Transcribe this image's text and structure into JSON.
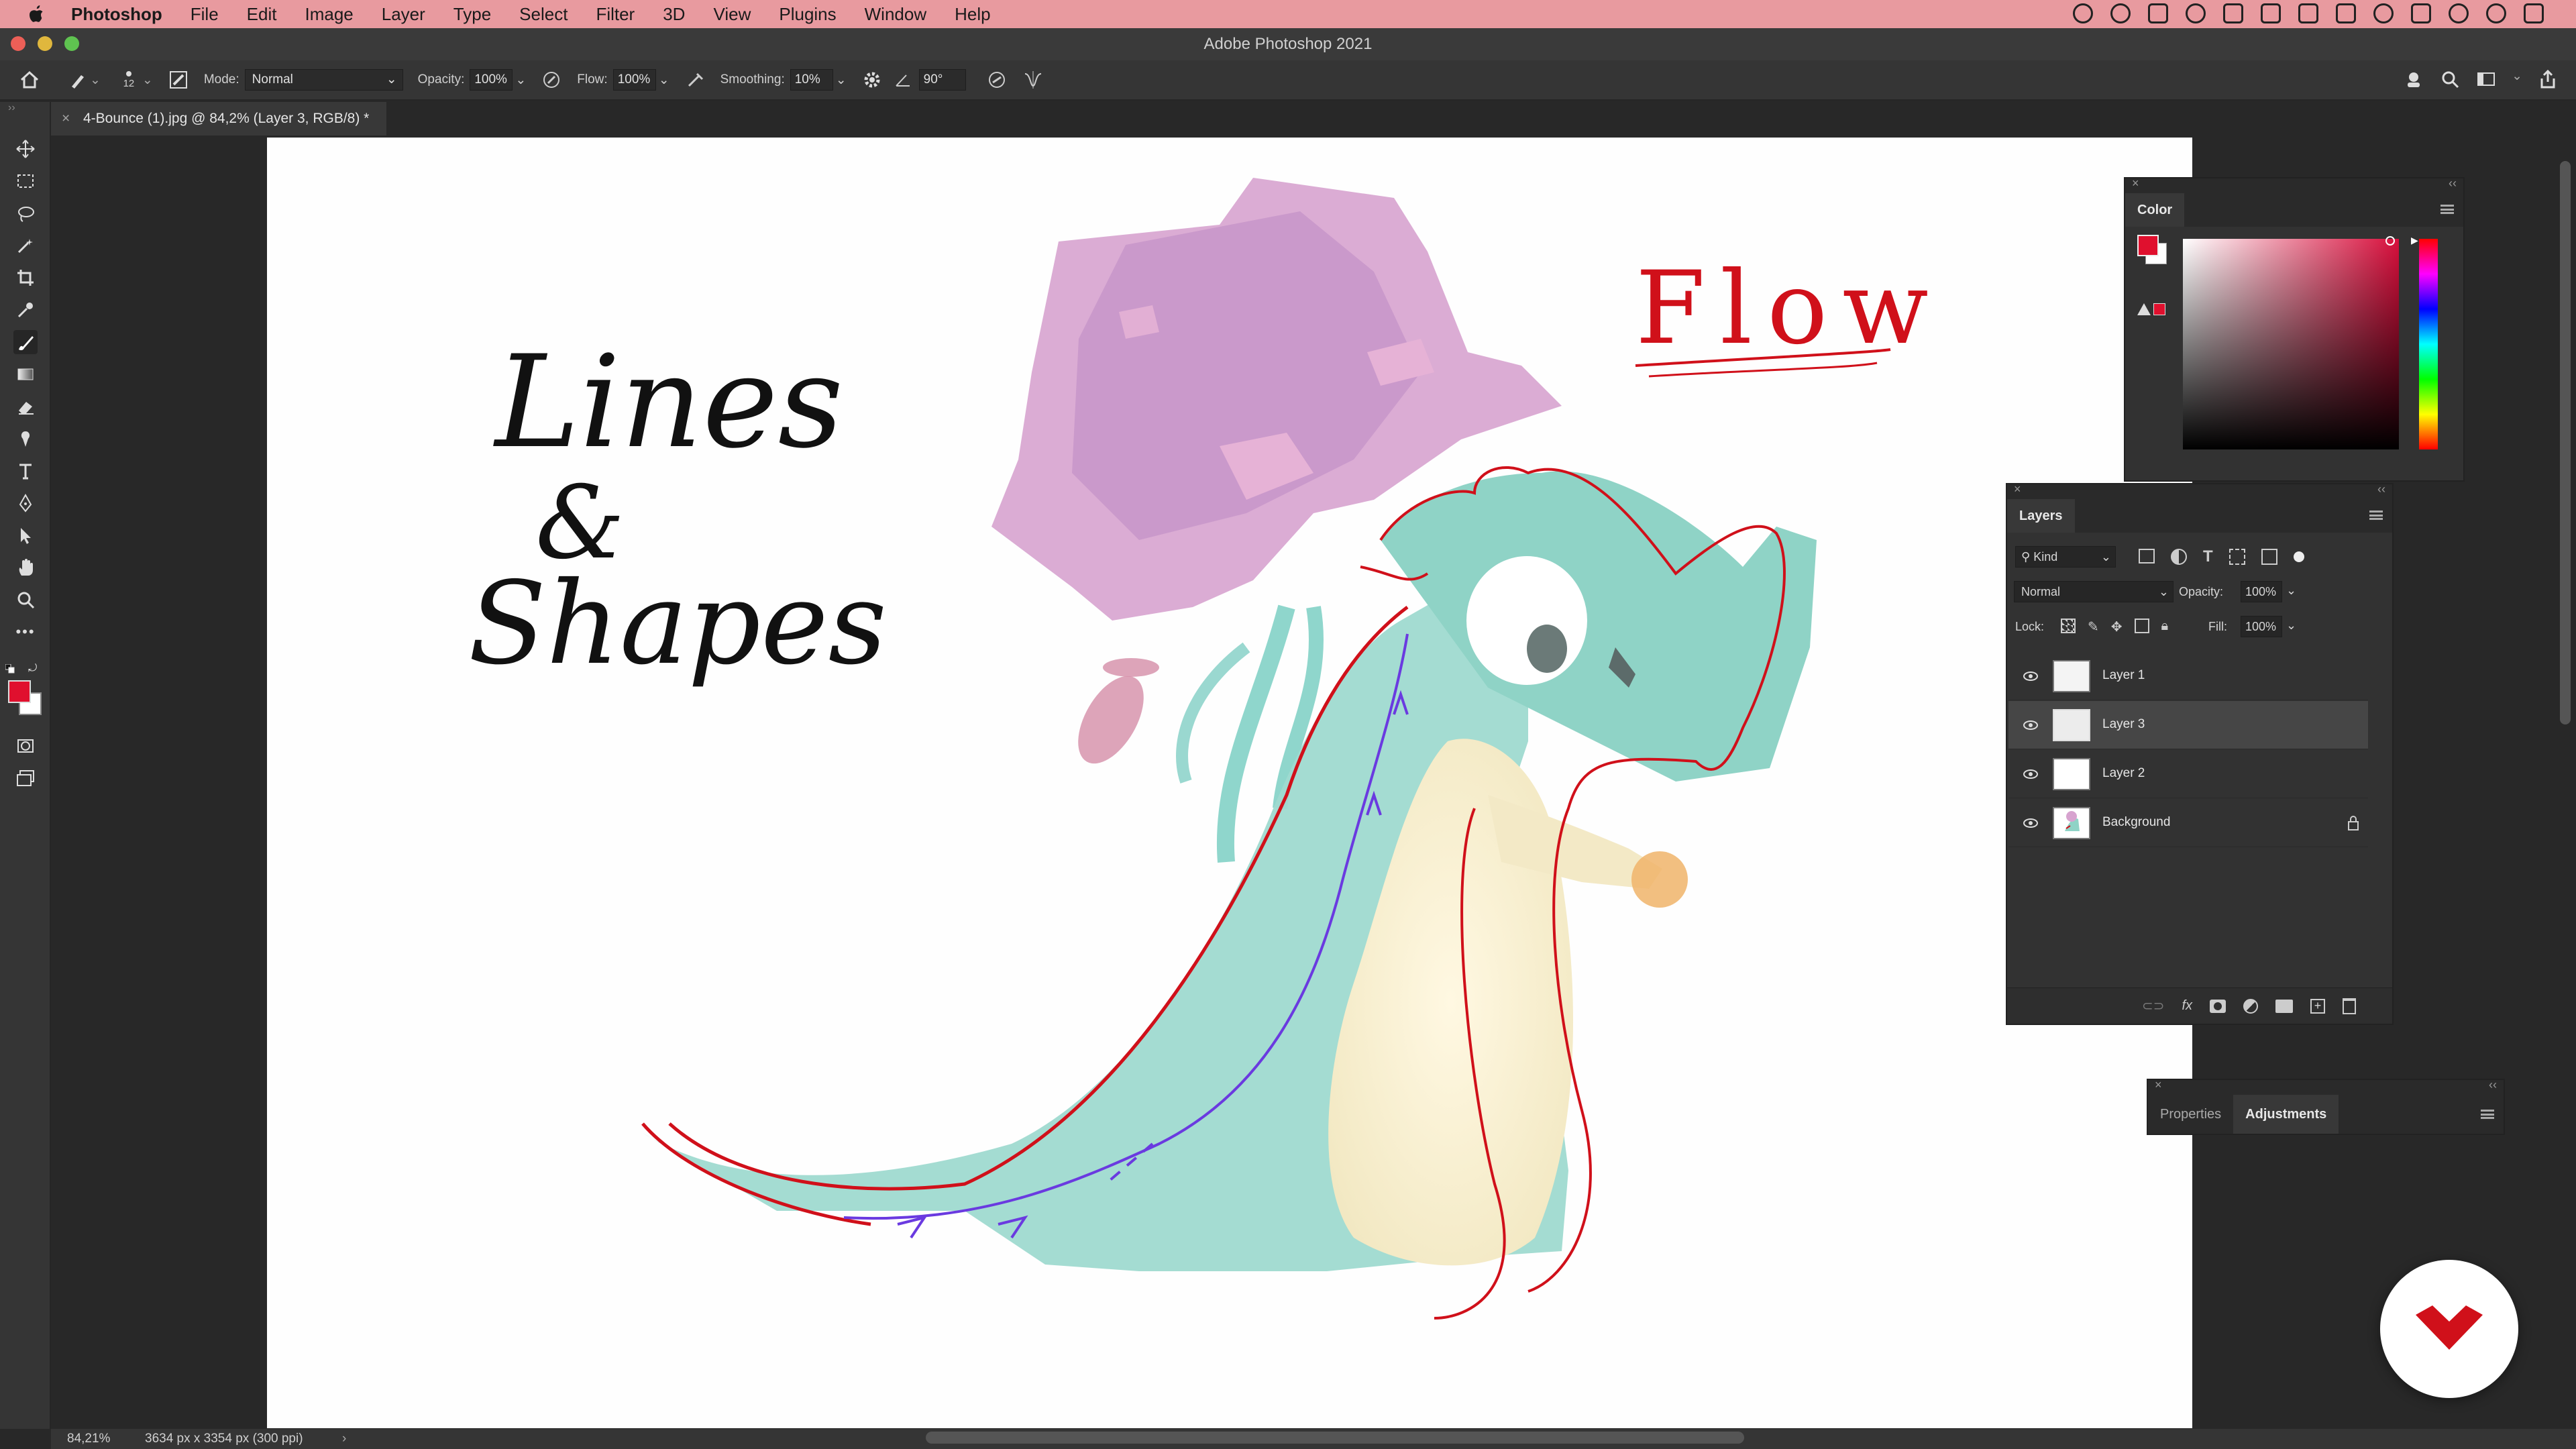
{
  "menubar": {
    "app_name": "Photoshop",
    "items": [
      "File",
      "Edit",
      "Image",
      "Layer",
      "Type",
      "Select",
      "Filter",
      "3D",
      "View",
      "Plugins",
      "Window",
      "Help"
    ]
  },
  "window": {
    "title": "Adobe Photoshop 2021"
  },
  "options_bar": {
    "brush_size": "12",
    "mode_label": "Mode:",
    "mode_value": "Normal",
    "opacity_label": "Opacity:",
    "opacity_value": "100%",
    "flow_label": "Flow:",
    "flow_value": "100%",
    "smoothing_label": "Smoothing:",
    "smoothing_value": "10%",
    "angle_value": "90°"
  },
  "document": {
    "tab_title": "4-Bounce (1).jpg @ 84,2% (Layer 3, RGB/8) *",
    "zoom": "84,21%",
    "dimensions": "3634 px x 3354 px (300 ppi)"
  },
  "canvas_text": {
    "line1": "Lines",
    "line2": "&",
    "line3": "Shapes",
    "flow": "Flow"
  },
  "color_panel": {
    "title": "Color",
    "foreground": "#e0102e",
    "background": "#ffffff"
  },
  "layers_panel": {
    "title": "Layers",
    "filter_kind": "Kind",
    "blend_mode": "Normal",
    "opacity_label": "Opacity:",
    "opacity_value": "100%",
    "lock_label": "Lock:",
    "fill_label": "Fill:",
    "fill_value": "100%",
    "layers": [
      {
        "name": "Layer 1",
        "selected": false
      },
      {
        "name": "Layer 3",
        "selected": true
      },
      {
        "name": "Layer 2",
        "selected": false
      },
      {
        "name": "Background",
        "selected": false,
        "locked": true
      }
    ]
  },
  "props_panel": {
    "tab1": "Properties",
    "tab2": "Adjustments"
  },
  "colors": {
    "menubar": "#e89a9f",
    "accent_red": "#d0101a"
  }
}
